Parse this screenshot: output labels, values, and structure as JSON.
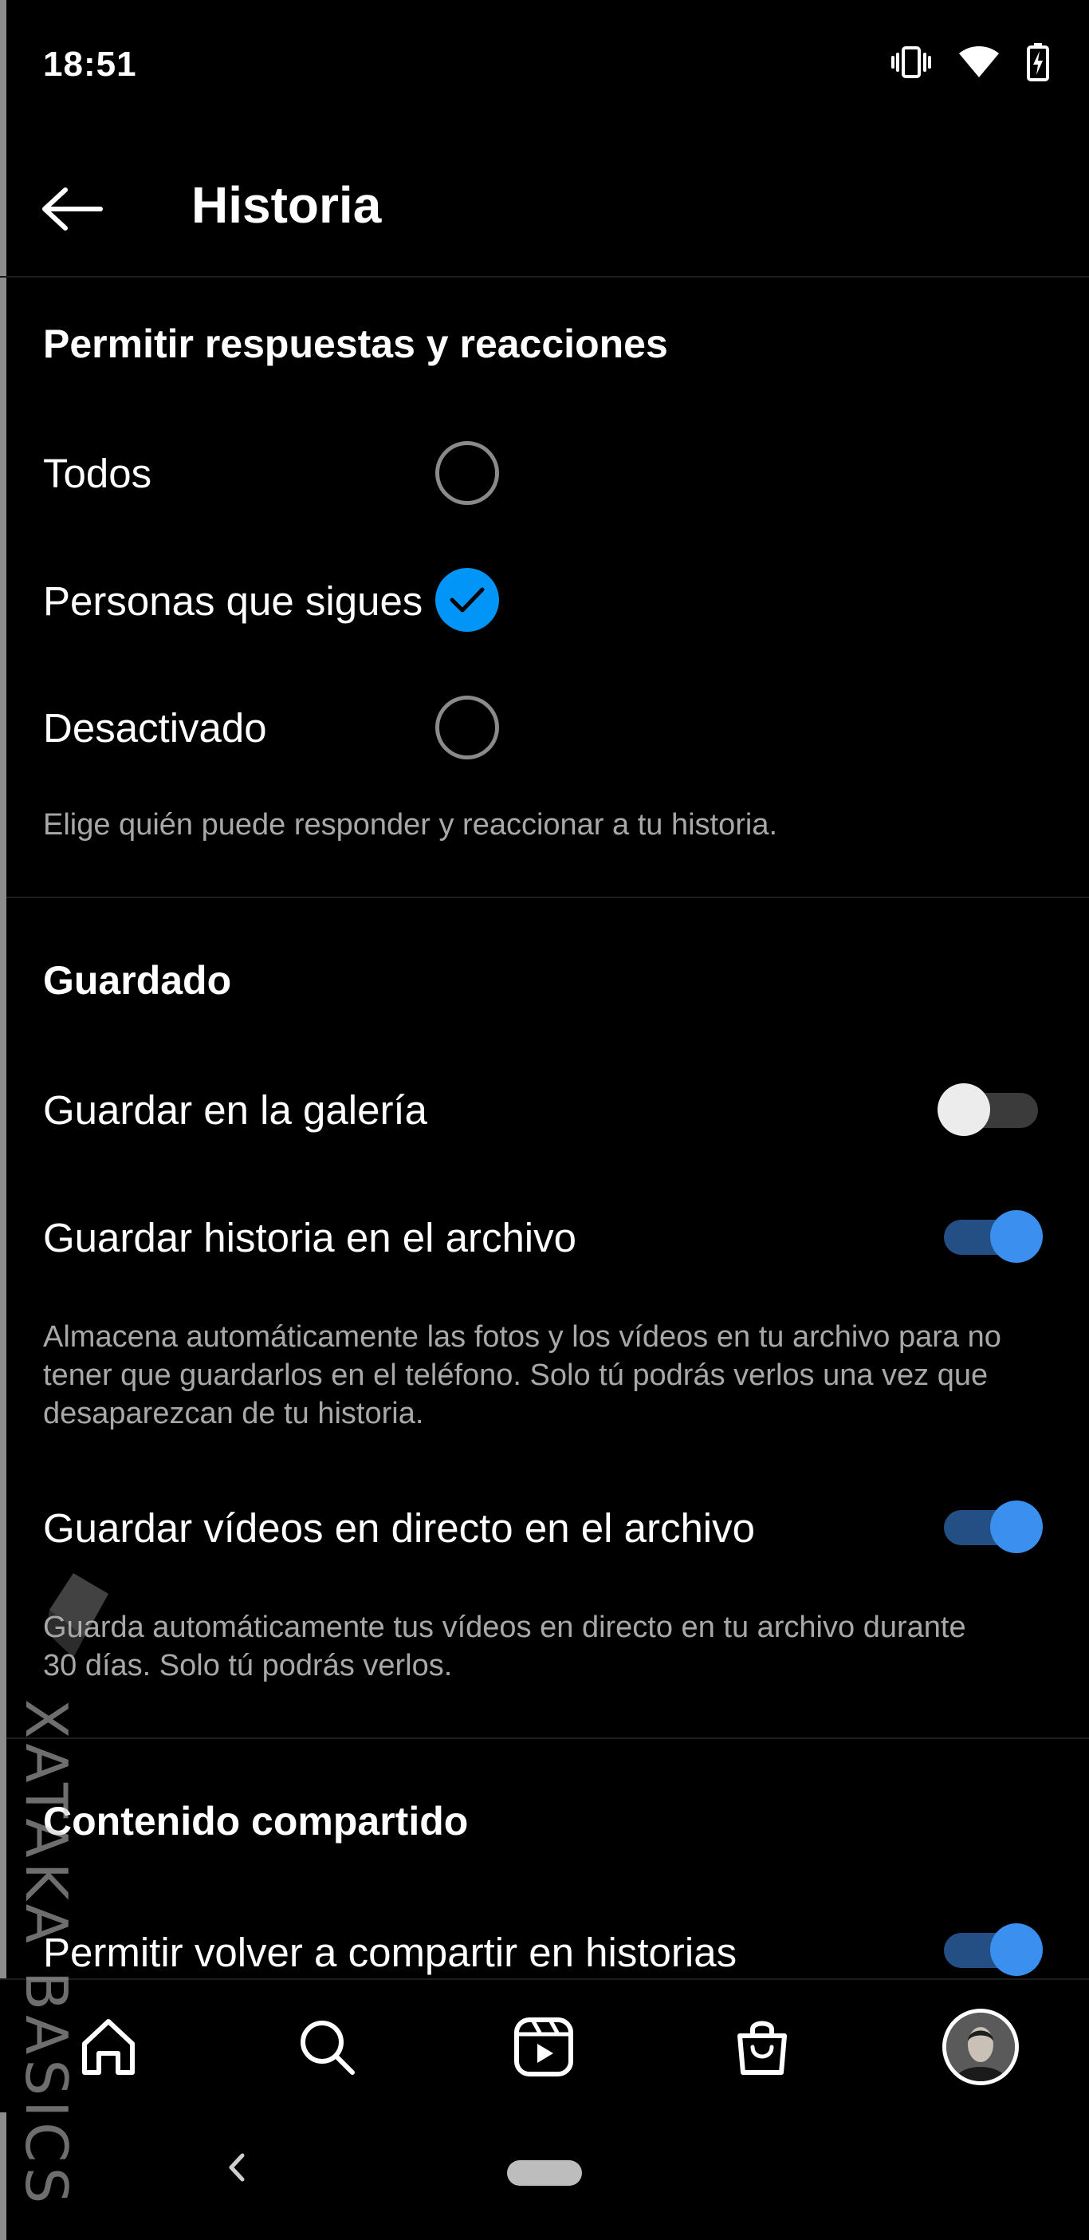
{
  "status_bar": {
    "time": "18:51",
    "icons": [
      "vibrate-icon",
      "wifi-icon",
      "battery-charging-icon"
    ]
  },
  "header": {
    "title": "Historia",
    "back_icon": "back-arrow-icon"
  },
  "replies_section": {
    "title": "Permitir respuestas y reacciones",
    "options": [
      {
        "label": "Todos",
        "selected": false
      },
      {
        "label": "Personas que sigues",
        "selected": true
      },
      {
        "label": "Desactivado",
        "selected": false
      }
    ],
    "caption": "Elige quién puede responder y reaccionar a tu historia."
  },
  "saving_section": {
    "title": "Guardado",
    "save_to_gallery": {
      "label": "Guardar en la galería",
      "enabled": false
    },
    "save_to_archive": {
      "label": "Guardar historia en el archivo",
      "enabled": true
    },
    "archive_caption_1": "Almacena automáticamente las fotos y los vídeos en tu archivo para no",
    "archive_caption_2": "tener que guardarlos en el teléfono. Solo tú podrás verlos una vez que",
    "archive_caption_3": "desaparezcan de tu historia.",
    "save_live": {
      "label": "Guardar vídeos en directo en el archivo",
      "enabled": true
    },
    "live_caption_1": "Guarda automáticamente tus vídeos en directo en tu archivo durante",
    "live_caption_2": "30 días. Solo tú podrás verlos."
  },
  "shared_section": {
    "title": "Contenido compartido",
    "allow_resharing": {
      "label": "Permitir volver a compartir en historias",
      "enabled": true
    }
  },
  "bottom_nav": {
    "items": [
      "home-icon",
      "search-icon",
      "reels-icon",
      "shop-icon",
      "profile-avatar"
    ]
  },
  "watermark": {
    "text": "XATAKA BASICS"
  },
  "colors": {
    "accent": "#0095f6",
    "toggle_on_track": "#244f84",
    "toggle_on_thumb": "#3b8fef",
    "background": "#000000"
  }
}
